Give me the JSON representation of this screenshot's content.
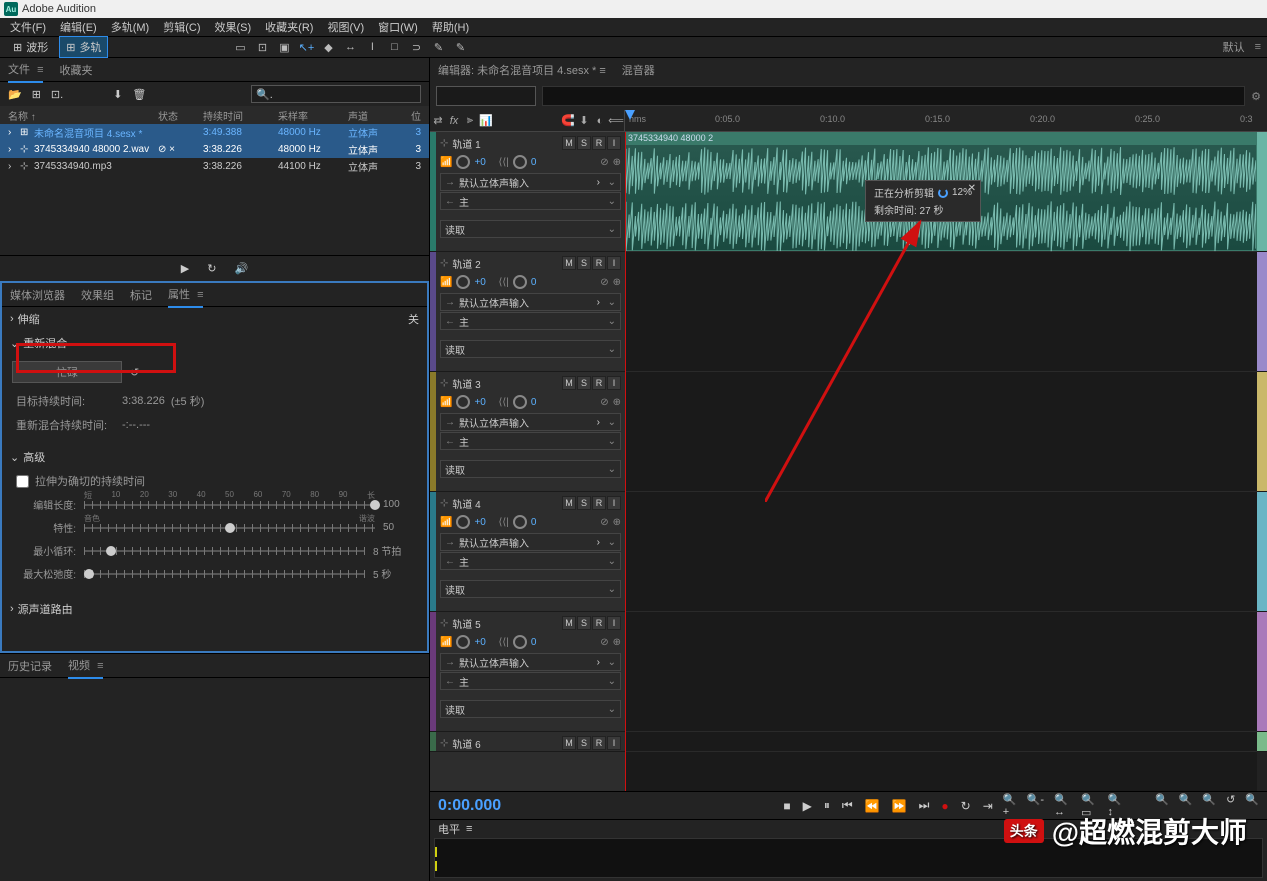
{
  "app": {
    "title": "Adobe Audition",
    "logo_text": "Au"
  },
  "menu": [
    "文件(F)",
    "编辑(E)",
    "多轨(M)",
    "剪辑(C)",
    "效果(S)",
    "收藏夹(R)",
    "视图(V)",
    "窗口(W)",
    "帮助(H)"
  ],
  "mode": {
    "waveform": "波形",
    "multitrack": "多轨",
    "default_label": "默认"
  },
  "files_panel": {
    "tabs": [
      "文件",
      "收藏夹"
    ],
    "headers": [
      "名称 ↑",
      "状态",
      "持续时间",
      "采样率",
      "声道",
      "位"
    ],
    "rows": [
      {
        "icon": "⊞",
        "name": "未命名混音项目 4.sesx *",
        "status": "",
        "duration": "3:49.388",
        "rate": "48000 Hz",
        "channels": "立体声",
        "bits": "3",
        "selected": true,
        "blue": true
      },
      {
        "icon": "⊹",
        "name": "3745334940 48000 2.wav",
        "status": "⊘ ×",
        "duration": "3:38.226",
        "rate": "48000 Hz",
        "channels": "立体声",
        "bits": "3",
        "selected": true
      },
      {
        "icon": "⊹",
        "name": "3745334940.mp3",
        "status": "",
        "duration": "3:38.226",
        "rate": "44100 Hz",
        "channels": "立体声",
        "bits": "3",
        "selected": false
      }
    ]
  },
  "props_panel": {
    "tabs": [
      "媒体浏览器",
      "效果组",
      "标记",
      "属性"
    ],
    "stretch_label": "伸缩",
    "close_label": "关",
    "remix_section": "重新混合",
    "remix_button": "忙碌",
    "target_duration_label": "目标持续时间:",
    "target_duration_value": "3:38.226",
    "target_duration_hint": "(±5 秒)",
    "remix_duration_label": "重新混合持续时间:",
    "remix_duration_value": "-:--.---",
    "advanced_label": "高级",
    "stretch_checkbox": "拉伸为确切的持续时间",
    "edit_length_label": "编辑长度:",
    "edit_length_ticks": [
      "短",
      "10",
      "20",
      "30",
      "40",
      "50",
      "60",
      "70",
      "80",
      "90",
      "长"
    ],
    "edit_length_value": "100",
    "feature_label": "特性:",
    "feature_ticks": [
      "音色",
      "",
      "",
      "",
      "",
      "",
      "",
      "",
      "",
      "",
      "谐波"
    ],
    "feature_value": "50",
    "min_loop_label": "最小循环:",
    "min_loop_value": "8 节拍",
    "max_slack_label": "最大松弛度:",
    "max_slack_value": "5 秒",
    "source_routing_label": "源声道路由"
  },
  "bottom_left": {
    "tabs": [
      "历史记录",
      "视频"
    ]
  },
  "editor": {
    "tab_editor": "编辑器: 未命名混音项目 4.sesx *",
    "tab_mixer": "混音器",
    "ruler_label": "hms",
    "ruler_ticks": [
      "0:05.0",
      "0:10.0",
      "0:15.0",
      "0:20.0",
      "0:25.0",
      "0:3"
    ],
    "clip_name": "3745334940 48000 2",
    "tracks": [
      {
        "name": "轨道 1",
        "color": "#2a7a6a",
        "vol": "+0",
        "pan": "0",
        "input": "默认立体声输入",
        "output": "主",
        "read": "读取",
        "mini": "#6ab5a5"
      },
      {
        "name": "轨道 2",
        "color": "#5a4a8a",
        "vol": "+0",
        "pan": "0",
        "input": "默认立体声输入",
        "output": "主",
        "read": "读取",
        "mini": "#9a8aca"
      },
      {
        "name": "轨道 3",
        "color": "#8a7a2a",
        "vol": "+0",
        "pan": "0",
        "input": "默认立体声输入",
        "output": "主",
        "read": "读取",
        "mini": "#cab86a"
      },
      {
        "name": "轨道 4",
        "color": "#2a7a8a",
        "vol": "+0",
        "pan": "0",
        "input": "默认立体声输入",
        "output": "主",
        "read": "读取",
        "mini": "#6ab5c5"
      },
      {
        "name": "轨道 5",
        "color": "#6a3a7a",
        "vol": "+0",
        "pan": "0",
        "input": "默认立体声输入",
        "output": "主",
        "read": "读取",
        "mini": "#aa7aba"
      },
      {
        "name": "轨道 6",
        "color": "#3a6a4a",
        "vol": "",
        "pan": "",
        "input": "",
        "output": "",
        "read": "",
        "mini": "#7aba8a"
      }
    ],
    "track_buttons": [
      "M",
      "S",
      "R",
      "I"
    ],
    "knob_icon": "◯"
  },
  "tooltip": {
    "analyzing": "正在分析剪辑",
    "progress": "12%",
    "remaining": "剩余时间: 27 秒"
  },
  "transport": {
    "timecode": "0:00.000"
  },
  "levels": {
    "label": "电平"
  },
  "watermark": {
    "badge": "头条",
    "text": "@超燃混剪大师"
  }
}
